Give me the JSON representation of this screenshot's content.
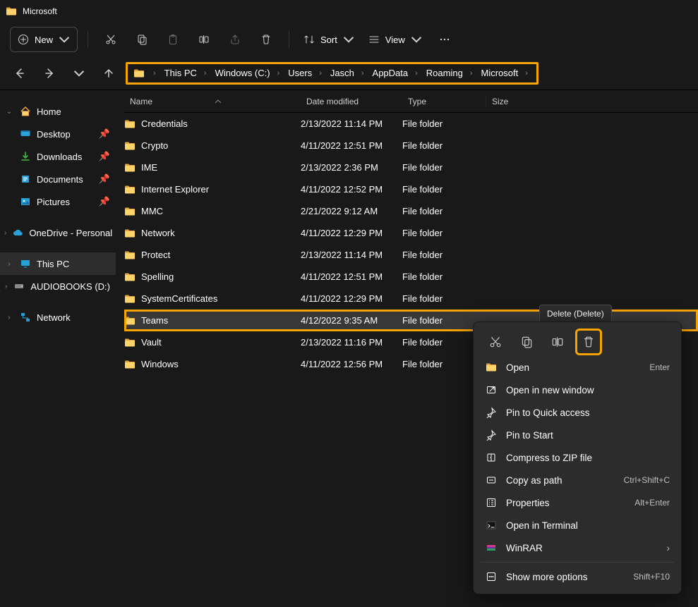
{
  "window": {
    "title": "Microsoft"
  },
  "toolbar": {
    "new": "New",
    "sort": "Sort",
    "view": "View"
  },
  "breadcrumb": [
    "This PC",
    "Windows (C:)",
    "Users",
    "Jasch",
    "AppData",
    "Roaming",
    "Microsoft"
  ],
  "columns": {
    "name": "Name",
    "date": "Date modified",
    "type": "Type",
    "size": "Size"
  },
  "sidebar": {
    "home": "Home",
    "quick": [
      {
        "label": "Desktop"
      },
      {
        "label": "Downloads"
      },
      {
        "label": "Documents"
      },
      {
        "label": "Pictures"
      }
    ],
    "onedrive": "OneDrive - Personal",
    "thispc": "This PC",
    "audiobooks": "AUDIOBOOKS (D:)",
    "network": "Network"
  },
  "rows": [
    {
      "name": "Credentials",
      "date": "2/13/2022 11:14 PM",
      "type": "File folder"
    },
    {
      "name": "Crypto",
      "date": "4/11/2022 12:51 PM",
      "type": "File folder"
    },
    {
      "name": "IME",
      "date": "2/13/2022 2:36 PM",
      "type": "File folder"
    },
    {
      "name": "Internet Explorer",
      "date": "4/11/2022 12:52 PM",
      "type": "File folder"
    },
    {
      "name": "MMC",
      "date": "2/21/2022 9:12 AM",
      "type": "File folder"
    },
    {
      "name": "Network",
      "date": "4/11/2022 12:29 PM",
      "type": "File folder"
    },
    {
      "name": "Protect",
      "date": "2/13/2022 11:14 PM",
      "type": "File folder"
    },
    {
      "name": "Spelling",
      "date": "4/11/2022 12:51 PM",
      "type": "File folder"
    },
    {
      "name": "SystemCertificates",
      "date": "4/11/2022 12:29 PM",
      "type": "File folder"
    },
    {
      "name": "Teams",
      "date": "4/12/2022 9:35 AM",
      "type": "File folder",
      "selected": true
    },
    {
      "name": "Vault",
      "date": "2/13/2022 11:16 PM",
      "type": "File folder"
    },
    {
      "name": "Windows",
      "date": "4/11/2022 12:56 PM",
      "type": "File folder"
    }
  ],
  "tooltip": "Delete (Delete)",
  "ctx": {
    "open": "Open",
    "open_sc": "Enter",
    "open_new": "Open in new window",
    "pin_quick": "Pin to Quick access",
    "pin_start": "Pin to Start",
    "zip": "Compress to ZIP file",
    "copy_path": "Copy as path",
    "copy_path_sc": "Ctrl+Shift+C",
    "props": "Properties",
    "props_sc": "Alt+Enter",
    "terminal": "Open in Terminal",
    "winrar": "WinRAR",
    "more": "Show more options",
    "more_sc": "Shift+F10"
  }
}
